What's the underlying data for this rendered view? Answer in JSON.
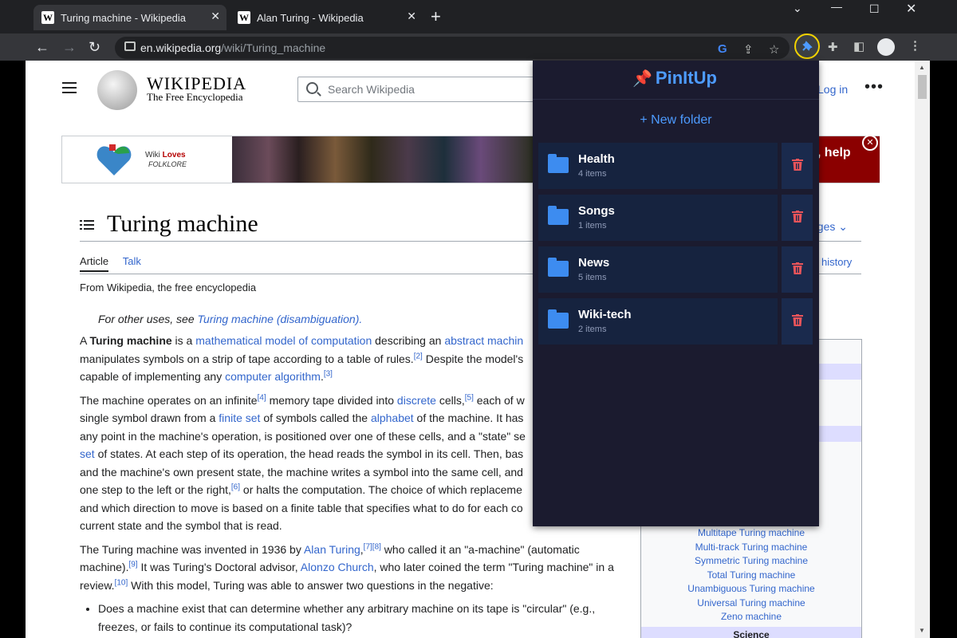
{
  "browser": {
    "tabs": [
      {
        "title": "Turing machine - Wikipedia",
        "favicon": "W",
        "active": true
      },
      {
        "title": "Alan Turing - Wikipedia",
        "favicon": "W",
        "active": false
      }
    ],
    "new_tab": "+",
    "url_host": "en.wikipedia.org",
    "url_path": "/wiki/Turing_machine"
  },
  "wiki": {
    "wordmark": "WIKIPEDIA",
    "tagline": "The Free Encyclopedia",
    "search_placeholder": "Search Wikipedia",
    "login": "Log in",
    "more": "•••",
    "banner": {
      "wiki": "Wiki ",
      "loves": "Loves",
      "folklore": "FOLKLORE",
      "cta": "e, help"
    },
    "title": "Turing machine",
    "languages": "ages",
    "tab_article": "Article",
    "tab_talk": "Talk",
    "view_history": "w history",
    "from": "From Wikipedia, the free encyclopedia",
    "hatnote_prefix": "For other uses, see ",
    "hatnote_link": "Turing machine (disambiguation).",
    "infobox_items": [
      "Multitape Turing machine",
      "Multi-track Turing machine",
      "Symmetric Turing machine",
      "Total Turing machine",
      "Unambiguous Turing machine",
      "Universal Turing machine",
      "Zeno machine"
    ],
    "infobox_partial": "e",
    "infobox_section": "Science"
  },
  "popup": {
    "brand": "PinItUp",
    "new_folder": "+ New folder",
    "folders": [
      {
        "name": "Health",
        "count": "4 items"
      },
      {
        "name": "Songs",
        "count": "1 items"
      },
      {
        "name": "News",
        "count": "5 items"
      },
      {
        "name": "Wiki-tech",
        "count": "2 items"
      }
    ]
  },
  "colors": {
    "accent": "#4d9bff",
    "delete": "#e8545a",
    "popup_bg": "#1b1b2f",
    "folder_bg": "#16233f"
  }
}
